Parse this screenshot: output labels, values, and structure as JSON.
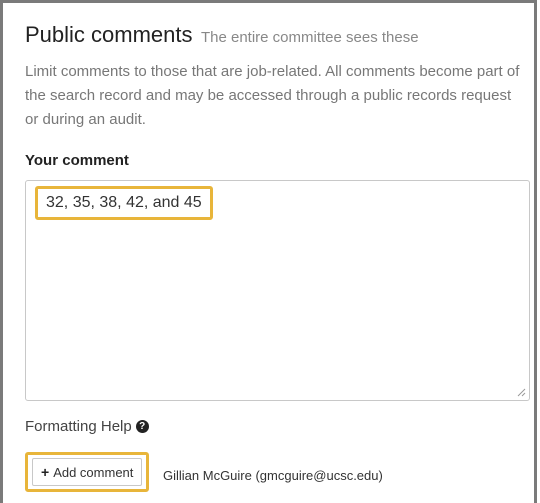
{
  "section": {
    "title": "Public comments",
    "subtitle": "The entire committee sees these"
  },
  "help_text": "Limit comments to those that are job-related. All comments become part of the search record and may be accessed through a public records request or during an audit.",
  "comment": {
    "label": "Your comment",
    "value": "32, 35, 38, 42, and 45"
  },
  "formatting_help": {
    "label": "Formatting Help",
    "icon": "question-circle-icon"
  },
  "actions": {
    "add_label": "Add comment",
    "plus_icon": "+",
    "author": "Gillian McGuire (gmcguire@ucsc.edu)"
  },
  "colors": {
    "highlight": "#e8b53a",
    "panel_border": "#7a7a7a"
  }
}
